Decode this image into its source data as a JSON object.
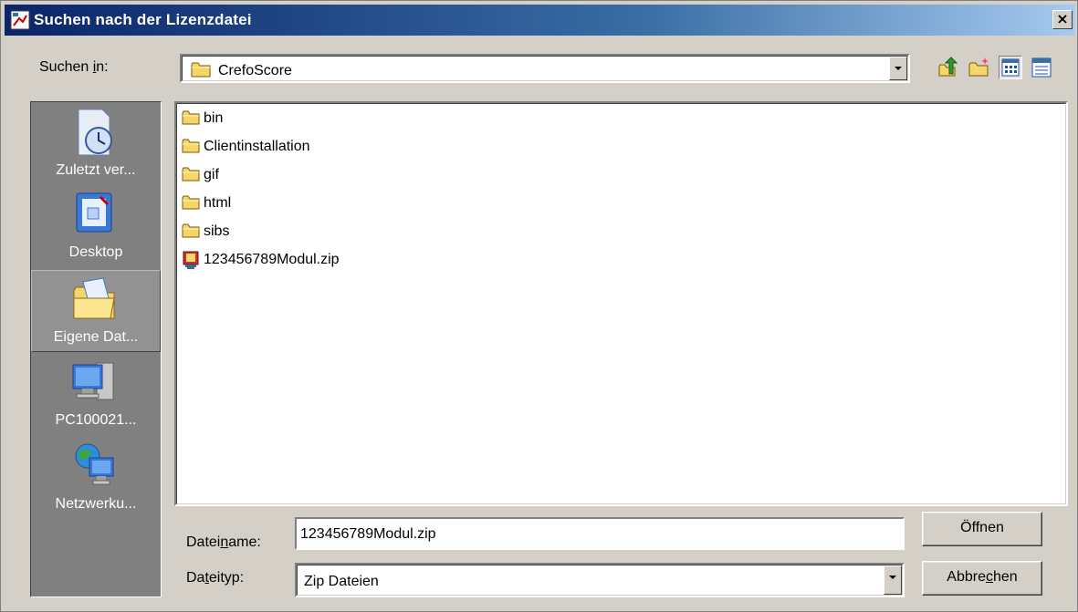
{
  "window": {
    "title": "Suchen nach der Lizenzdatei",
    "close_glyph": "×"
  },
  "look_in": {
    "label_pre": "Suchen ",
    "label_mnemonic": "i",
    "label_post": "n:",
    "value": "CrefoScore",
    "icon": "folder-icon"
  },
  "toolbar": {
    "icons": [
      "up-one-level-icon",
      "new-folder-icon",
      "list-view-icon",
      "details-view-icon"
    ],
    "active": "list-view-icon"
  },
  "places": {
    "items": [
      {
        "label": "Zuletzt ver...",
        "icon": "recent-documents-icon"
      },
      {
        "label": "Desktop",
        "icon": "desktop-icon"
      },
      {
        "label": "Eigene Dat...",
        "icon": "my-documents-icon",
        "selected": true
      },
      {
        "label": "PC100021...",
        "icon": "my-computer-icon"
      },
      {
        "label": "Netzwerku...",
        "icon": "network-icon"
      }
    ]
  },
  "files": {
    "items": [
      {
        "name": "bin",
        "type": "folder"
      },
      {
        "name": "Clientinstallation",
        "type": "folder"
      },
      {
        "name": "gif",
        "type": "folder"
      },
      {
        "name": "html",
        "type": "folder"
      },
      {
        "name": "sibs",
        "type": "folder"
      },
      {
        "name": "123456789Modul.zip",
        "type": "zip"
      }
    ]
  },
  "filename": {
    "label_pre": "Datei",
    "label_mnemonic": "n",
    "label_post": "ame:",
    "value": "123456789Modul.zip"
  },
  "filetype": {
    "label_pre": "Da",
    "label_mnemonic": "t",
    "label_post": "eityp:",
    "value": "Zip Dateien"
  },
  "buttons": {
    "open": "Öffnen",
    "cancel_pre": "Abbre",
    "cancel_mnemonic": "c",
    "cancel_post": "hen"
  },
  "colors": {
    "title_start": "#0a246a",
    "title_end": "#a6caf0",
    "face": "#d4d0c8",
    "places_bg": "#808080",
    "folder": "#f5d66b"
  }
}
